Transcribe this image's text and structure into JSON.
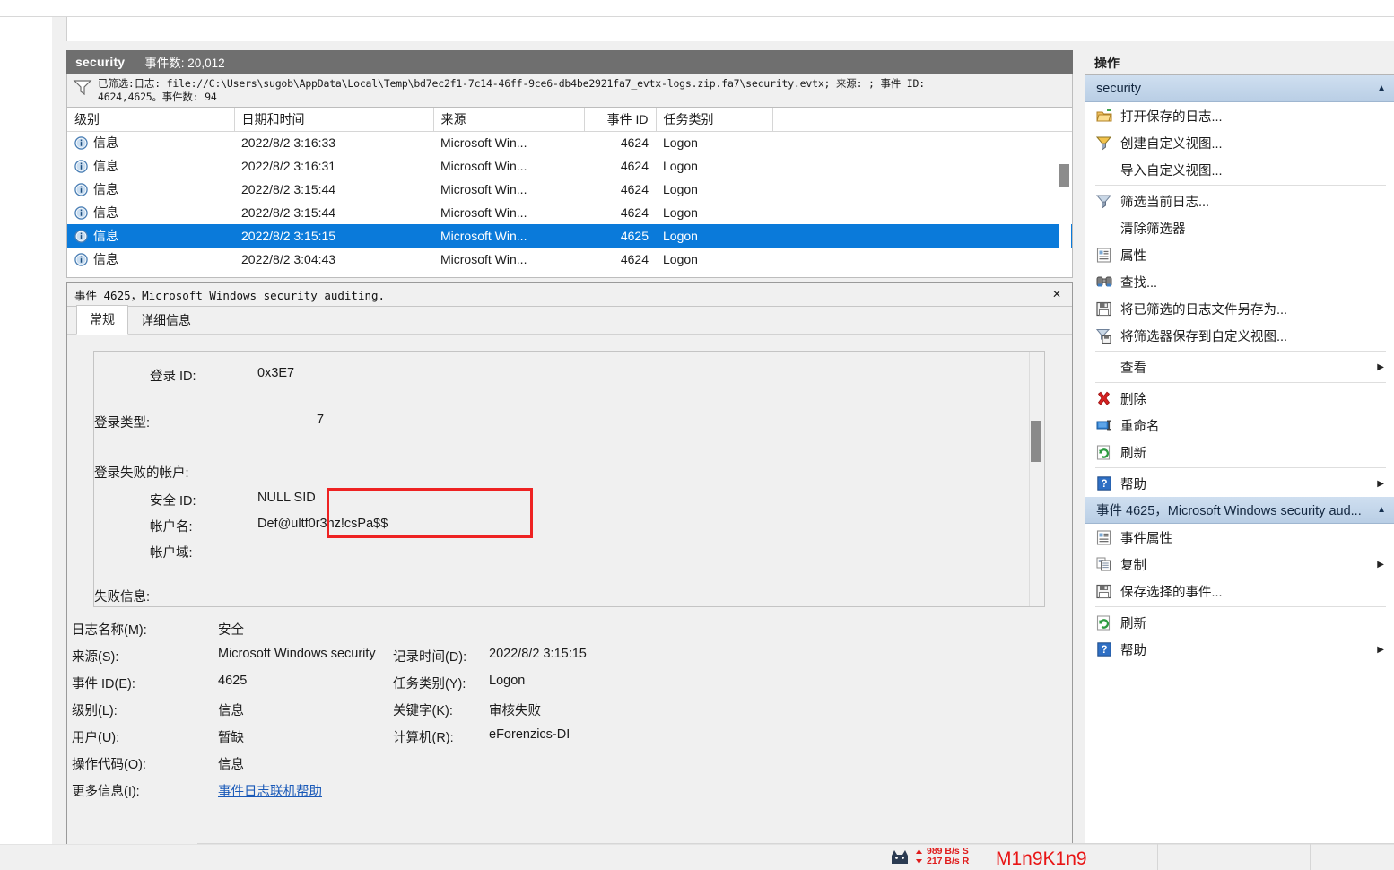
{
  "window": {
    "log_name": "security",
    "event_count_label": "事件数: 20,012",
    "filter_text": "已筛选:日志: file://C:\\Users\\sugob\\AppData\\Local\\Temp\\bd7ec2f1-7c14-46ff-9ce6-db4be2921fa7_evtx-logs.zip.fa7\\security.evtx; 来源: ; 事件 ID:\n4624,4625。事件数: 94"
  },
  "event_list": {
    "columns": [
      "级别",
      "日期和时间",
      "来源",
      "事件 ID",
      "任务类别"
    ],
    "rows": [
      {
        "level": "信息",
        "datetime": "2022/8/2 3:16:33",
        "source": "Microsoft Win...",
        "event_id": "4624",
        "task": "Logon",
        "selected": false
      },
      {
        "level": "信息",
        "datetime": "2022/8/2 3:16:31",
        "source": "Microsoft Win...",
        "event_id": "4624",
        "task": "Logon",
        "selected": false
      },
      {
        "level": "信息",
        "datetime": "2022/8/2 3:15:44",
        "source": "Microsoft Win...",
        "event_id": "4624",
        "task": "Logon",
        "selected": false
      },
      {
        "level": "信息",
        "datetime": "2022/8/2 3:15:44",
        "source": "Microsoft Win...",
        "event_id": "4624",
        "task": "Logon",
        "selected": false
      },
      {
        "level": "信息",
        "datetime": "2022/8/2 3:15:15",
        "source": "Microsoft Win...",
        "event_id": "4625",
        "task": "Logon",
        "selected": true
      },
      {
        "level": "信息",
        "datetime": "2022/8/2 3:04:43",
        "source": "Microsoft Win...",
        "event_id": "4624",
        "task": "Logon",
        "selected": false
      }
    ]
  },
  "detail": {
    "title": "事件 4625，Microsoft Windows security auditing.",
    "close_label": "✕",
    "tabs": [
      {
        "label": "常规",
        "active": true
      },
      {
        "label": "详细信息",
        "active": false
      }
    ],
    "body": {
      "logon_id_label": "登录 ID:",
      "logon_id_value": "0x3E7",
      "logon_type_label": "登录类型:",
      "logon_type_value": "7",
      "failed_account_header": "登录失败的帐户:",
      "security_id_label": "安全 ID:",
      "security_id_value": "NULL SID",
      "account_name_label": "帐户名:",
      "account_name_value": "Def@ultf0r3nz!csPa$$",
      "account_domain_label": "帐户域:",
      "account_domain_value": "",
      "failure_info_label": "失败信息:"
    },
    "fields": {
      "log_name_label": "日志名称(M):",
      "log_name_value": "安全",
      "source_label": "来源(S):",
      "source_value": "Microsoft Windows security",
      "logged_label": "记录时间(D):",
      "logged_value": "2022/8/2 3:15:15",
      "event_id_label": "事件 ID(E):",
      "event_id_value": "4625",
      "task_category_label": "任务类别(Y):",
      "task_category_value": "Logon",
      "level_label": "级别(L):",
      "level_value": "信息",
      "keywords_label": "关键字(K):",
      "keywords_value": "审核失败",
      "user_label": "用户(U):",
      "user_value": "暂缺",
      "computer_label": "计算机(R):",
      "computer_value": "eForenzics-DI",
      "opcode_label": "操作代码(O):",
      "opcode_value": "信息",
      "more_info_label": "更多信息(I):",
      "more_info_link": "事件日志联机帮助"
    }
  },
  "actions_pane": {
    "title": "操作",
    "groups": [
      {
        "header": "security",
        "caret": "▲",
        "items": [
          {
            "label": "打开保存的日志...",
            "icon": "open-folder-icon",
            "arrow": ""
          },
          {
            "label": "创建自定义视图...",
            "icon": "funnel-yellow-icon",
            "arrow": ""
          },
          {
            "label": "导入自定义视图...",
            "icon": "",
            "arrow": ""
          },
          {
            "label": "筛选当前日志...",
            "icon": "funnel-icon",
            "arrow": "",
            "sep_before": true
          },
          {
            "label": "清除筛选器",
            "icon": "",
            "arrow": ""
          },
          {
            "label": "属性",
            "icon": "properties-icon",
            "arrow": ""
          },
          {
            "label": "查找...",
            "icon": "binoculars-icon",
            "arrow": ""
          },
          {
            "label": "将已筛选的日志文件另存为...",
            "icon": "save-icon",
            "arrow": ""
          },
          {
            "label": "将筛选器保存到自定义视图...",
            "icon": "save-filter-icon",
            "arrow": ""
          },
          {
            "label": "查看",
            "icon": "",
            "arrow": "▶",
            "sep_before": true
          },
          {
            "label": "删除",
            "icon": "delete-x-icon",
            "arrow": "",
            "sep_before": true
          },
          {
            "label": "重命名",
            "icon": "rename-icon",
            "arrow": ""
          },
          {
            "label": "刷新",
            "icon": "refresh-icon",
            "arrow": ""
          },
          {
            "label": "帮助",
            "icon": "help-icon",
            "arrow": "▶",
            "sep_before": true
          }
        ]
      },
      {
        "header": "事件 4625，Microsoft Windows security aud...",
        "caret": "▲",
        "items": [
          {
            "label": "事件属性",
            "icon": "properties-icon",
            "arrow": ""
          },
          {
            "label": "复制",
            "icon": "copy-icon",
            "arrow": "▶"
          },
          {
            "label": "保存选择的事件...",
            "icon": "save-icon",
            "arrow": ""
          },
          {
            "label": "刷新",
            "icon": "refresh-icon",
            "arrow": "",
            "sep_before": true
          },
          {
            "label": "帮助",
            "icon": "help-icon",
            "arrow": "▶"
          }
        ]
      }
    ]
  },
  "status": {
    "upload_rate": "989 B/s S",
    "download_rate": "217 B/s R",
    "watermark": "M1n9K1n9"
  },
  "colors": {
    "selection_blue": "#0a7ada",
    "header_gray": "#6f6f6f",
    "highlight_red": "#ee2222",
    "watermark_red": "#e81515",
    "link_blue": "#1959b8",
    "group_header_blue": "#b9cee5"
  }
}
